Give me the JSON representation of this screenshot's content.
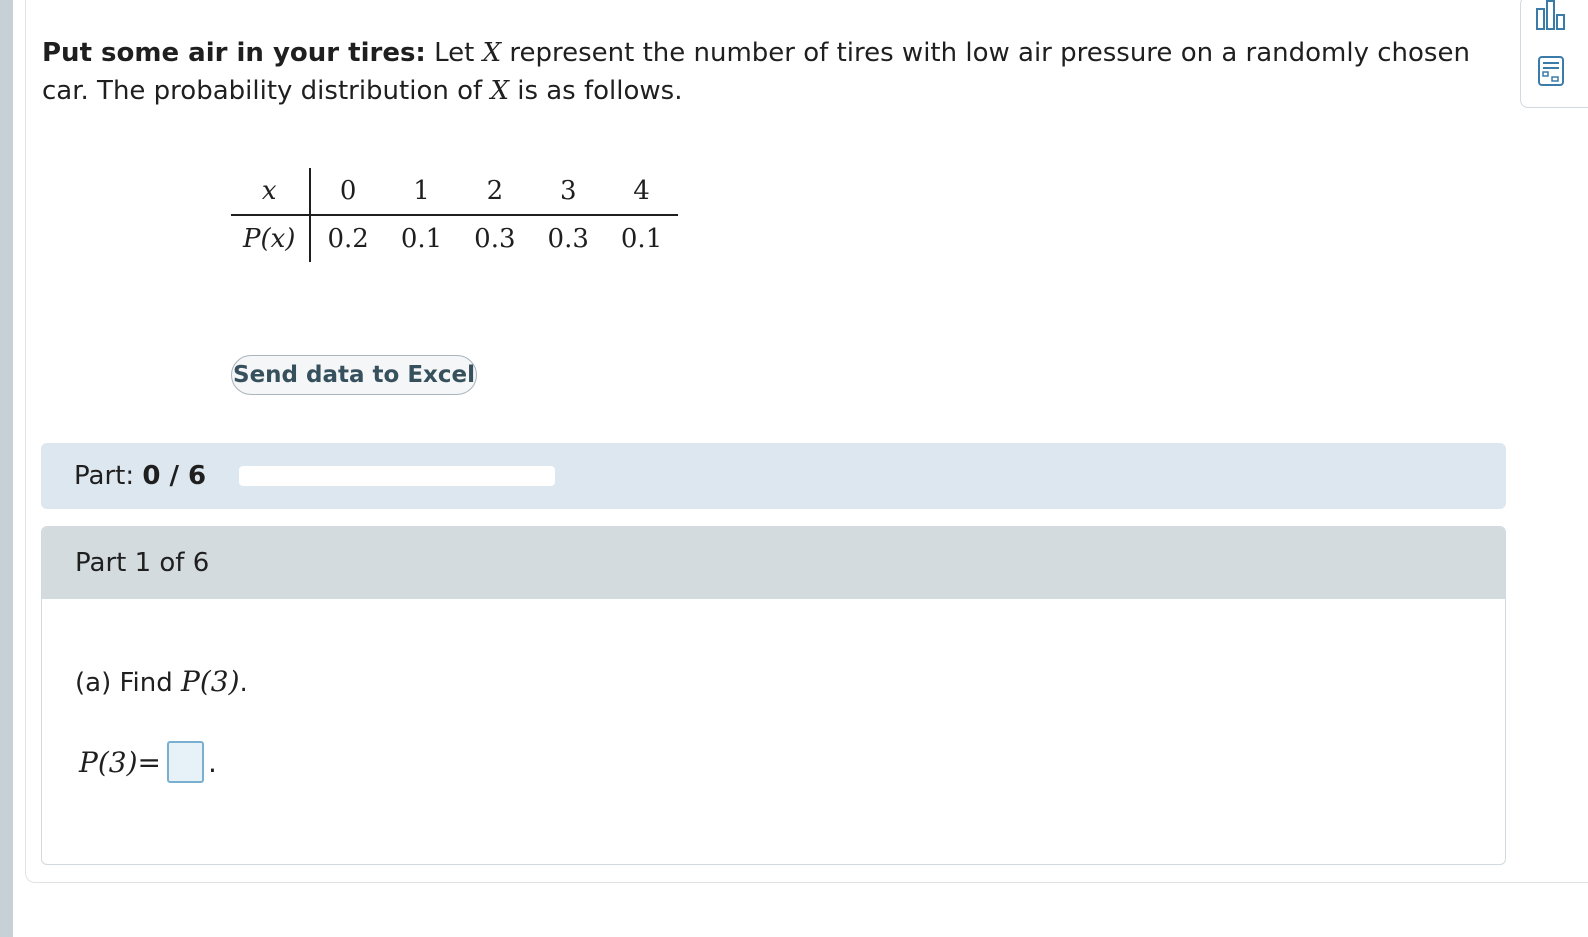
{
  "problem": {
    "title": "Put some air in your tires:",
    "text_1": "Let",
    "var_X": "X",
    "text_2": "represent the number of tires with low air pressure on a randomly chosen car. The probability distribution of",
    "text_3": "is as follows."
  },
  "distribution": {
    "x_label": "x",
    "p_label": "P(x)",
    "x_values": [
      "0",
      "1",
      "2",
      "3",
      "4"
    ],
    "p_values": [
      "0.2",
      "0.1",
      "0.3",
      "0.3",
      "0.1"
    ]
  },
  "excel_button": {
    "label": "Send data to Excel"
  },
  "progress": {
    "label": "Part:",
    "value": "0 / 6",
    "fraction": 0
  },
  "part": {
    "header": "Part 1 of 6",
    "question_prefix": "(a) Find",
    "question_expr": "P(3)",
    "question_suffix": ".",
    "answer_lhs": "P(3)=",
    "answer_value": "",
    "answer_suffix": "."
  },
  "tools": {
    "icons": [
      "bar-chart-icon",
      "calculator-icon"
    ]
  }
}
